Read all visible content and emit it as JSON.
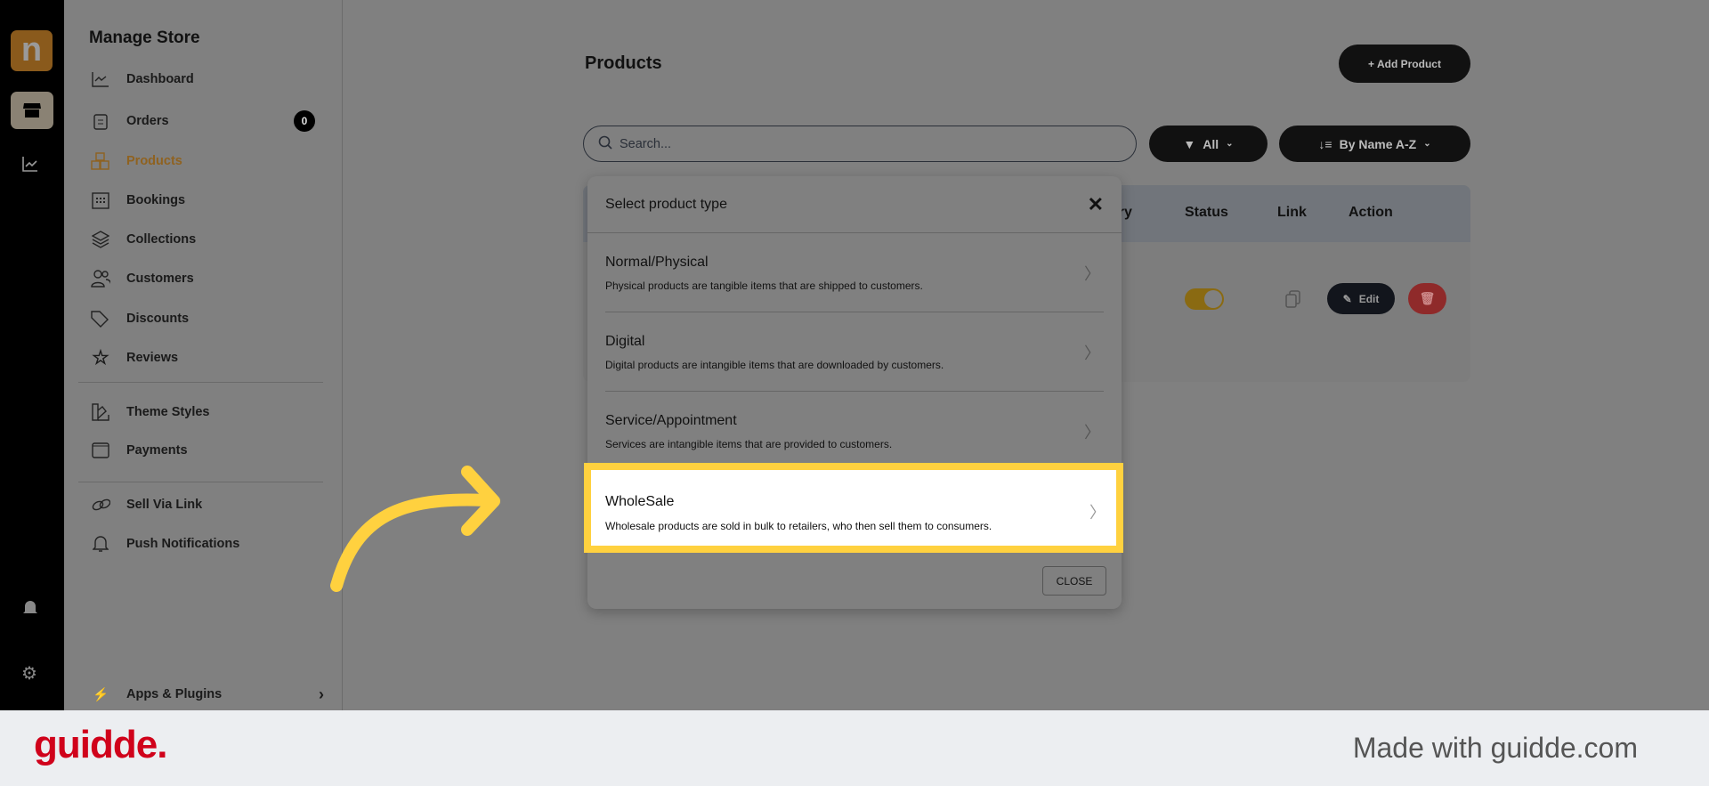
{
  "rail": {
    "logo_letter": "n"
  },
  "sidebar": {
    "title": "Manage Store",
    "items": [
      {
        "label": "Dashboard",
        "icon": "chart-line-icon"
      },
      {
        "label": "Orders",
        "icon": "clipboard-icon",
        "badge": "0"
      },
      {
        "label": "Products",
        "icon": "boxes-icon",
        "active": true
      },
      {
        "label": "Bookings",
        "icon": "calendar-icon"
      },
      {
        "label": "Collections",
        "icon": "layers-icon"
      },
      {
        "label": "Customers",
        "icon": "users-icon"
      },
      {
        "label": "Discounts",
        "icon": "tag-icon"
      },
      {
        "label": "Reviews",
        "icon": "star-icon"
      },
      {
        "label": "Theme Styles",
        "icon": "palette-icon"
      },
      {
        "label": "Payments",
        "icon": "wallet-icon"
      },
      {
        "label": "Sell Via Link",
        "icon": "link-icon"
      },
      {
        "label": "Push Notifications",
        "icon": "bell-icon"
      }
    ],
    "apps_label": "Apps & Plugins"
  },
  "main": {
    "title": "Products",
    "add_label": "+ Add Product",
    "search_placeholder": "Search...",
    "filter_label": "All",
    "sort_label": "By Name A-Z",
    "columns": [
      "ory",
      "Status",
      "Link",
      "Action"
    ],
    "edit_label": "Edit"
  },
  "modal": {
    "title": "Select product type",
    "options": [
      {
        "title": "Normal/Physical",
        "desc": "Physical products are tangible items that are shipped to customers."
      },
      {
        "title": "Digital",
        "desc": "Digital products are intangible items that are downloaded by customers."
      },
      {
        "title": "Service/Appointment",
        "desc": "Services are intangible items that are provided to customers."
      },
      {
        "title": "WholeSale",
        "desc": "Wholesale products are sold in bulk to retailers, who then sell them to consumers."
      }
    ],
    "close_label": "CLOSE"
  },
  "footer": {
    "logo": "guidde.",
    "made_with": "Made with guidde.com"
  },
  "colors": {
    "accent": "#c48a2e",
    "highlight": "#ffd13f",
    "brand": "#d0021b"
  }
}
